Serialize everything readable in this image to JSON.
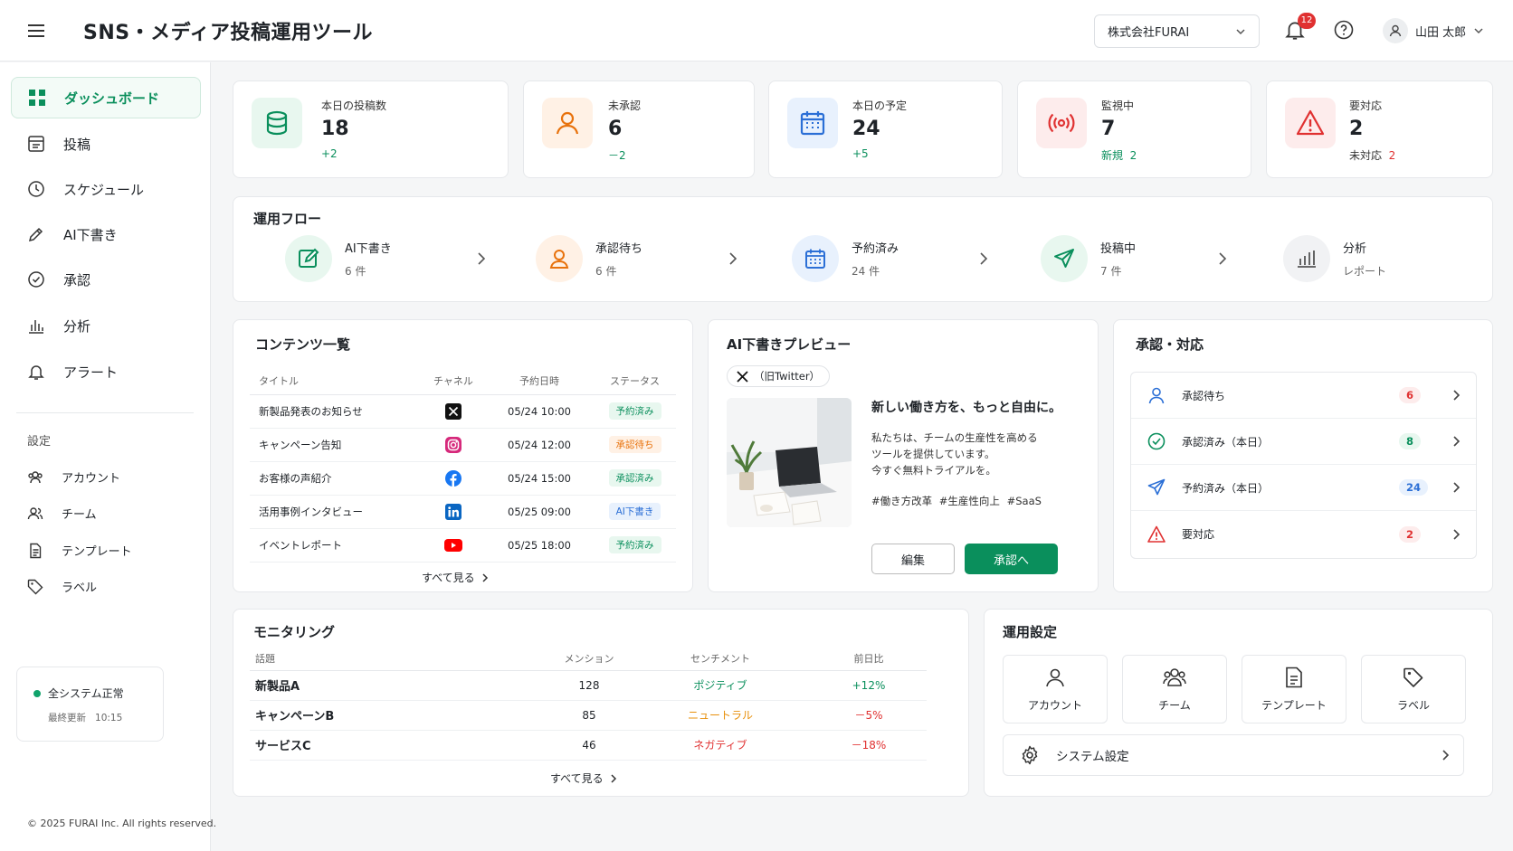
{
  "header": {
    "title": "SNS・メディア投稿運用ツール",
    "company": "株式会社FURAI",
    "notification_count": "12",
    "user_name": "山田 太郎"
  },
  "sidebar": {
    "items": [
      {
        "label": "ダッシュボード",
        "icon": "grid-icon"
      },
      {
        "label": "投稿",
        "icon": "post-icon"
      },
      {
        "label": "スケジュール",
        "icon": "clock-icon"
      },
      {
        "label": "AI下書き",
        "icon": "pencil-icon"
      },
      {
        "label": "承認",
        "icon": "check-circle-icon"
      },
      {
        "label": "分析",
        "icon": "bar-chart-icon"
      },
      {
        "label": "アラート",
        "icon": "bell-icon"
      }
    ],
    "settings_title": "設定",
    "settings_items": [
      {
        "label": "アカウント"
      },
      {
        "label": "チーム"
      },
      {
        "label": "テンプレート"
      },
      {
        "label": "ラベル"
      }
    ],
    "status": {
      "text": "全システム正常",
      "updated_label": "最終更新",
      "updated_time": "10:15"
    }
  },
  "footer": "© 2025 FURAI Inc. All rights reserved.",
  "stats": [
    {
      "label": "本日の投稿数",
      "value": "18",
      "sub": "+2",
      "sub_color": "#0a8f5c"
    },
    {
      "label": "未承認",
      "value": "6",
      "sub": "－2",
      "sub_color": "#0a8f5c"
    },
    {
      "label": "本日の予定",
      "value": "24",
      "sub": "+5",
      "sub_color": "#0a8f5c"
    },
    {
      "label": "監視中",
      "value": "7",
      "sub_label": "新規",
      "sub": "2",
      "sub_color": "#0a8f5c"
    },
    {
      "label": "要対応",
      "value": "2",
      "sub_label": "未対応",
      "sub": "2",
      "sub_color": "#e03131"
    }
  ],
  "flow": {
    "title": "運用フロー",
    "steps": [
      {
        "label": "AI下書き",
        "count": "6 件"
      },
      {
        "label": "承認待ち",
        "count": "6 件"
      },
      {
        "label": "予約済み",
        "count": "24 件"
      },
      {
        "label": "投稿中",
        "count": "7 件"
      },
      {
        "label": "分析",
        "count": "レポート"
      }
    ]
  },
  "content_list": {
    "title": "コンテンツ一覧",
    "headers": [
      "タイトル",
      "チャネル",
      "予約日時",
      "ステータス"
    ],
    "rows": [
      {
        "title": "新製品発表のお知らせ",
        "channel": "x-icon",
        "date": "05/24  10:00",
        "status": "予約済み",
        "kind": "ok"
      },
      {
        "title": "キャンペーン告知",
        "channel": "instagram-icon",
        "date": "05/24  12:00",
        "status": "承認待ち",
        "kind": "wait"
      },
      {
        "title": "お客様の声紹介",
        "channel": "facebook-icon",
        "date": "05/24  15:00",
        "status": "承認済み",
        "kind": "ok"
      },
      {
        "title": "活用事例インタビュー",
        "channel": "linkedin-icon",
        "date": "05/25  09:00",
        "status": "AI下書き",
        "kind": "ai"
      },
      {
        "title": "イベントレポート",
        "channel": "youtube-icon",
        "date": "05/25  18:00",
        "status": "予約済み",
        "kind": "ok"
      }
    ],
    "see_all": "すべて見る"
  },
  "preview": {
    "title": "AI下書きプレビュー",
    "channel": "（旧Twitter）",
    "headline": "新しい働き方を、もっと自由に。",
    "body": [
      "私たちは、チームの生産性を高める",
      "ツールを提供しています。",
      "今すぐ無料トライアルを。"
    ],
    "tags": "#働き方改革 #生産性向上 #SaaS",
    "edit_label": "編集",
    "approve_label": "承認へ"
  },
  "approval": {
    "title": "承認・対応",
    "rows": [
      {
        "label": "承認待ち",
        "count": "6",
        "fg": "#e03131",
        "bg": "#fdecec"
      },
      {
        "label": "承認済み（本日）",
        "count": "8",
        "fg": "#0a8f5c",
        "bg": "#e8f7ef"
      },
      {
        "label": "予約済み（本日）",
        "count": "24",
        "fg": "#2b6fd6",
        "bg": "#e8f1fd"
      },
      {
        "label": "要対応",
        "count": "2",
        "fg": "#e03131",
        "bg": "#fdecec"
      }
    ]
  },
  "monitoring": {
    "title": "モニタリング",
    "headers": [
      "話題",
      "メンション",
      "センチメント",
      "前日比"
    ],
    "rows": [
      {
        "topic": "新製品A",
        "mentions": "128",
        "sentiment": "ポジティブ",
        "s_color": "#0a8f5c",
        "change": "+12%",
        "c_color": "#0a8f5c"
      },
      {
        "topic": "キャンペーンB",
        "mentions": "85",
        "sentiment": "ニュートラル",
        "s_color": "#e8900c",
        "change": "－5%",
        "c_color": "#e03131"
      },
      {
        "topic": "サービスC",
        "mentions": "46",
        "sentiment": "ネガティブ",
        "s_color": "#e03131",
        "change": "－18%",
        "c_color": "#e03131"
      }
    ],
    "see_all": "すべて見る"
  },
  "ops_settings": {
    "title": "運用設定",
    "tiles": [
      {
        "label": "アカウント"
      },
      {
        "label": "チーム"
      },
      {
        "label": "テンプレート"
      },
      {
        "label": "ラベル"
      }
    ],
    "system_label": "システム設定"
  },
  "colors": {
    "accent": "#0a8f5c",
    "danger": "#e03131",
    "warning": "#e8720c",
    "info": "#2b6fd6"
  }
}
